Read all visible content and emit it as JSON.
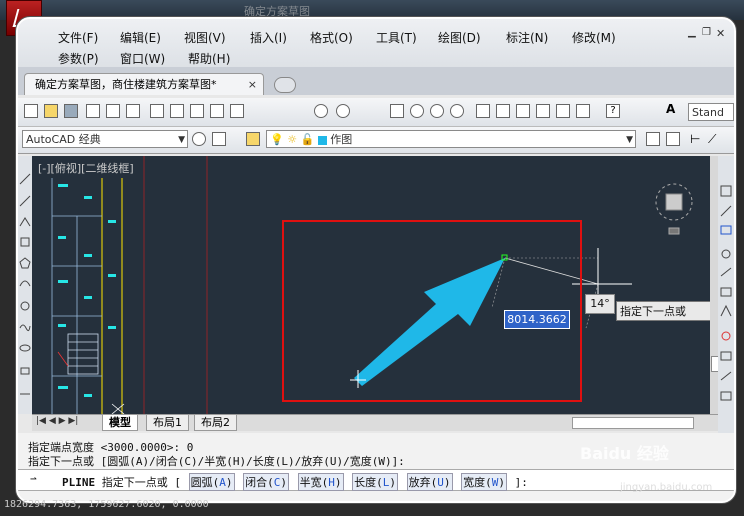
{
  "app": {
    "title": "确定方案草图",
    "document_tab": "确定方案草图，商住楼建筑方案草图*",
    "document_tab_close": "×"
  },
  "menu": {
    "row1": [
      "文件(F)",
      "编辑(E)",
      "视图(V)",
      "插入(I)",
      "格式(O)",
      "工具(T)",
      "绘图(D)",
      "标注(N)",
      "修改(M)"
    ],
    "row2": [
      "参数(P)",
      "窗口(W)",
      "帮助(H)"
    ]
  },
  "toolbar": {
    "workspace": "AutoCAD 经典",
    "layer": "作图",
    "style": "Stand"
  },
  "canvas": {
    "view_label": "[-][俯视][二维线框]",
    "dynamic_input_value": "8014.3662",
    "angle": "14°",
    "tooltip": "指定下一点或"
  },
  "layout_tabs": [
    "模型",
    "布局1",
    "布局2"
  ],
  "command": {
    "line1": "指定端点宽度 <3000.0000>: 0",
    "line2": "指定下一点或 [圆弧(A)/闭合(C)/半宽(H)/长度(L)/放弃(U)/宽度(W)]:",
    "prompt_cmd": "PLINE",
    "prompt_text": "指定下一点或 [",
    "options": [
      {
        "label": "圆弧(",
        "key": "A",
        "tail": ")"
      },
      {
        "label": "闭合(",
        "key": "C",
        "tail": ")"
      },
      {
        "label": "半宽(",
        "key": "H",
        "tail": ")"
      },
      {
        "label": "长度(",
        "key": "L",
        "tail": ")"
      },
      {
        "label": "放弃(",
        "key": "U",
        "tail": ")"
      },
      {
        "label": "宽度(",
        "key": "W",
        "tail": ")"
      }
    ],
    "prompt_end": "]:"
  },
  "status": {
    "coords": "1826294.7363, 1759627.6020, 0.0000"
  },
  "watermark": {
    "brand": "Baidu 经验",
    "url": "jingyan.baidu.com"
  },
  "colors": {
    "canvas": "#25303c",
    "arrow": "#1fb8e8",
    "highlight": "#e01010"
  }
}
